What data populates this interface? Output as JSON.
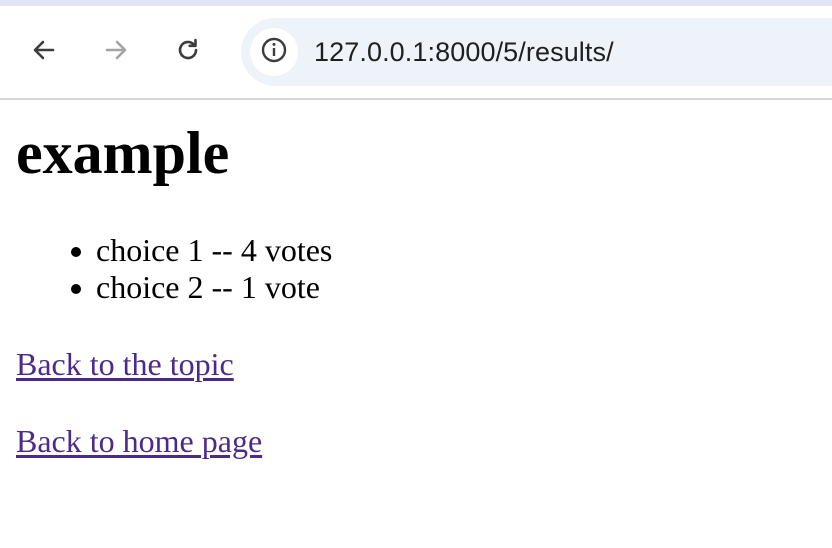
{
  "browser": {
    "url": "127.0.0.1:8000/5/results/",
    "icons": {
      "back": "arrow-left",
      "forward": "arrow-right",
      "reload": "circular-arrow",
      "site_info": "info-circle"
    }
  },
  "page": {
    "title": "example",
    "results": [
      {
        "text": "choice 1 -- 4 votes"
      },
      {
        "text": "choice 2 -- 1 vote"
      }
    ],
    "links": {
      "back_to_topic": "Back to the topic",
      "back_to_home": "Back to home page"
    }
  },
  "colors": {
    "link_visited": "#4b2a8a",
    "omnibox_bg": "#eef2f9",
    "toolbar_border": "#d4d6da"
  }
}
